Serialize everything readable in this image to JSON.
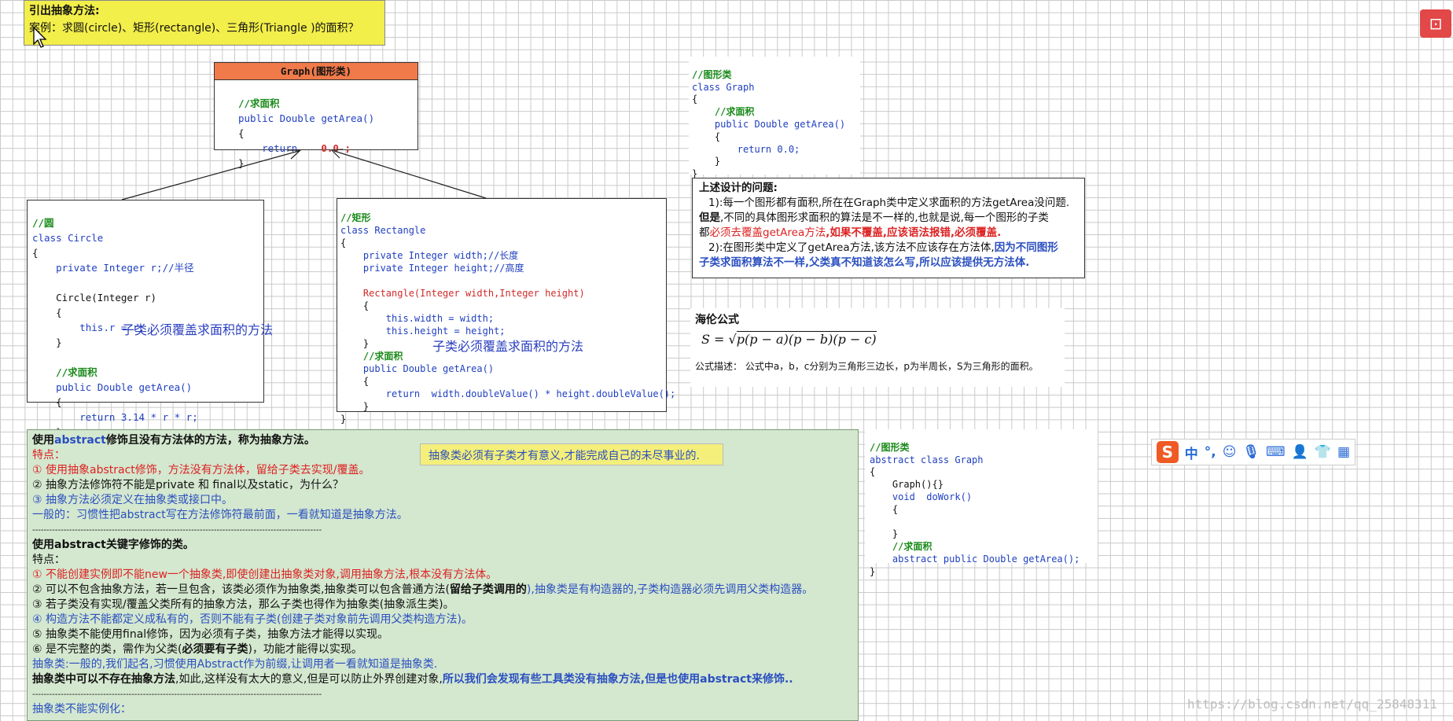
{
  "top_note": {
    "title": "引出抽象方法:",
    "text": "案例：求圆(circle)、矩形(rectangle)、三角形(Triangle )的面积？"
  },
  "graph_box": {
    "header": "Graph(图形类)",
    "lines": [
      "//求面积",
      "public Double getArea()",
      "{",
      "return",
      "0.0 ;",
      "}"
    ]
  },
  "circle_box": {
    "comment": "//圆",
    "lines": [
      "class Circle",
      "{",
      "private Integer r;//半径",
      "Circle(Integer r)",
      "{",
      "this.r = r;",
      "}",
      "//求面积",
      "public Double getArea()",
      "{",
      "return 3.14 * r * r;",
      "}",
      "}"
    ],
    "handwritten": "子类必须覆盖求面积的方法"
  },
  "rect_box": {
    "comment": "//矩形",
    "lines": [
      "class Rectangle",
      "{",
      "private Integer width;//长度",
      "private Integer height;//高度",
      "Rectangle(Integer width,Integer height)",
      "{",
      "this.width = width;",
      "this.height = height;",
      "}",
      "//求面积",
      "public Double getArea()",
      "{",
      "return  width.doubleValue() * height.doubleValue();",
      "}",
      "}"
    ],
    "handwritten": "子类必须覆盖求面积的方法"
  },
  "graph_code": {
    "lines": [
      "//图形类",
      "class Graph",
      "{",
      "//求面积",
      "public Double getArea()",
      "{",
      "return 0.0;",
      "}",
      "}"
    ]
  },
  "problem_box": {
    "title": "上述设计的问题:",
    "p1_a": "1):每一个图形都有面积,所在在Graph类中定义求面积的方法getArea没问题.",
    "p1_b": "但是",
    "p1_c": ",不同的具体图形求面积的算法是不一样的,也就是说,每一个图形的子类",
    "p1_d": "都",
    "p1_e": "必须去覆盖getArea方法",
    "p1_f": ",如果不覆盖,应该语法报错,必须覆盖.",
    "p2_a": "2):在图形类中定义了getArea方法,该方法不应该存在方法体,",
    "p2_b": "因为不同图形",
    "p2_c": "子类求面积算法不一样,父类真不知道该怎么写,所以应该提供无方法体."
  },
  "heron": {
    "title": "海伦公式",
    "formula_lhs": "S =",
    "formula_rhs": "p(p − a)(p − b)(p − c)",
    "desc": "公式描述：  公式中a，b，c分别为三角形三边长，p为半周长，S为三角形的面积。"
  },
  "abstract_code": {
    "lines": [
      "//图形类",
      "abstract class Graph",
      "{",
      "Graph(){}",
      "void  doWork()",
      "{",
      "",
      "}",
      "//求面积",
      "abstract public Double getArea();",
      "}"
    ]
  },
  "green_box": {
    "h1_a": "使用",
    "h1_b": "abstract",
    "h1_c": "修饰且没有方法体的方法，称为抽象方法。",
    "features1": "特点：",
    "f1": "①    使用抽象abstract修饰，方法没有方法体，留给子类去实现/覆盖。",
    "f2": "②    抽象方法修饰符不能是private 和 final以及static，为什么？",
    "f3": "③    抽象方法必须定义在抽象类或接口中。",
    "general": "一般的：习惯性把abstract写在方法修饰符最前面，一看就知道是抽象方法。",
    "dash": "------------------------------------------------------------------------------------------------------",
    "h2": "使用abstract关键字修饰的类。",
    "features2": "特点：",
    "g1": "①    不能创建实例即不能new一个抽象类,即使创建出抽象类对象,调用抽象方法,根本没有方法体。",
    "g2_a": "②    可以不包含抽象方法，若一旦包含，该类必须作为抽象类,抽象类可以包含普通方法(",
    "g2_b": "留给子类调用的",
    "g2_c": "),抽象类是有构造器的,子类构造器必须先调用父类构造器。",
    "g3": "③    若子类没有实现/覆盖父类所有的抽象方法，那么子类也得作为抽象类(抽象派生类)。",
    "g4": "④    构造方法不能都定义成私有的，否则不能有子类(创建子类对象前先调用父类构造方法)。",
    "g5": "⑤    抽象类不能使用final修饰，因为必须有子类，抽象方法才能得以实现。",
    "g6_a": "⑥    是不完整的类，需作为父类(",
    "g6_b": "必须要有子类",
    "g6_c": ")，功能才能得以实现。",
    "naming": "抽象类:一般的,我们起名,习惯使用Abstract作为前缀,让调用者一看就知道是抽象类.",
    "last_a": "抽象类中可以不存在抽象方法",
    "last_b": ",如此,这样没有太大的意义,但是可以防止外界创建对象,",
    "last_c": "所以我们会发现有些工具类没有抽象方法,但是也使用abstract来修饰..",
    "dash2": "------------------------------------------------------------------------------------------------------",
    "cannot": "抽象类不能实例化："
  },
  "yellow_note": "抽象类必须有子类才有意义,才能完成自己的未尽事业的.",
  "watermark": "https://blog.csdn.net/qq_25848311",
  "ime_label": "中",
  "colors": {
    "green_bg": "#d4e7cf",
    "header_orange": "#f07a4a",
    "note_yellow": "#f2ee4a"
  }
}
